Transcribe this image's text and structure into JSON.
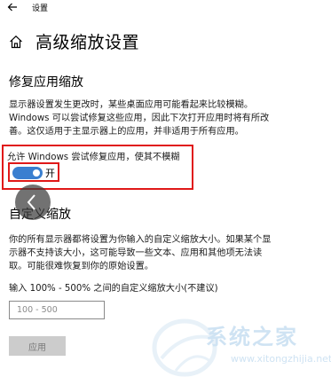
{
  "window": {
    "app_title": "设置",
    "back_icon": "arrow-left-icon"
  },
  "header": {
    "home_icon": "home-icon",
    "title": "高级缩放设置"
  },
  "fix_apps": {
    "heading": "修复应用缩放",
    "description_lines": [
      "显示器设置发生更改时，某些桌面应用可能看起来比较模糊。",
      "Windows 可以尝试修复这些应用，因此下次打开应用时将有所改",
      "善。这仅适用于主显示器上的应用，并非适用于所有应用。"
    ],
    "toggle_label": "允许 Windows 尝试修复应用，使其不模糊",
    "toggle_on": true,
    "toggle_state_text": "开",
    "highlight_color": "#e01818",
    "toggle_color": "#3a7fd0"
  },
  "custom_scaling": {
    "heading": "自定义缩放",
    "description_lines": [
      "你的所有显示器都将设置为你输入的自定义缩放大小。如果某个显",
      "示器不支持该大小，这可能导致一些文本、应用和其他项无法读",
      "取。可能很难恢复到你的原始设置。"
    ],
    "input_label": "输入 100% - 500% 之间的自定义缩放大小(不建议)",
    "input_value": "",
    "input_placeholder": "100 - 500",
    "apply_label": "应用"
  },
  "overlay": {
    "icon": "chevron-left-icon"
  },
  "watermark": {
    "text": "系统之家",
    "url": "www.xitongzhijia.net"
  }
}
